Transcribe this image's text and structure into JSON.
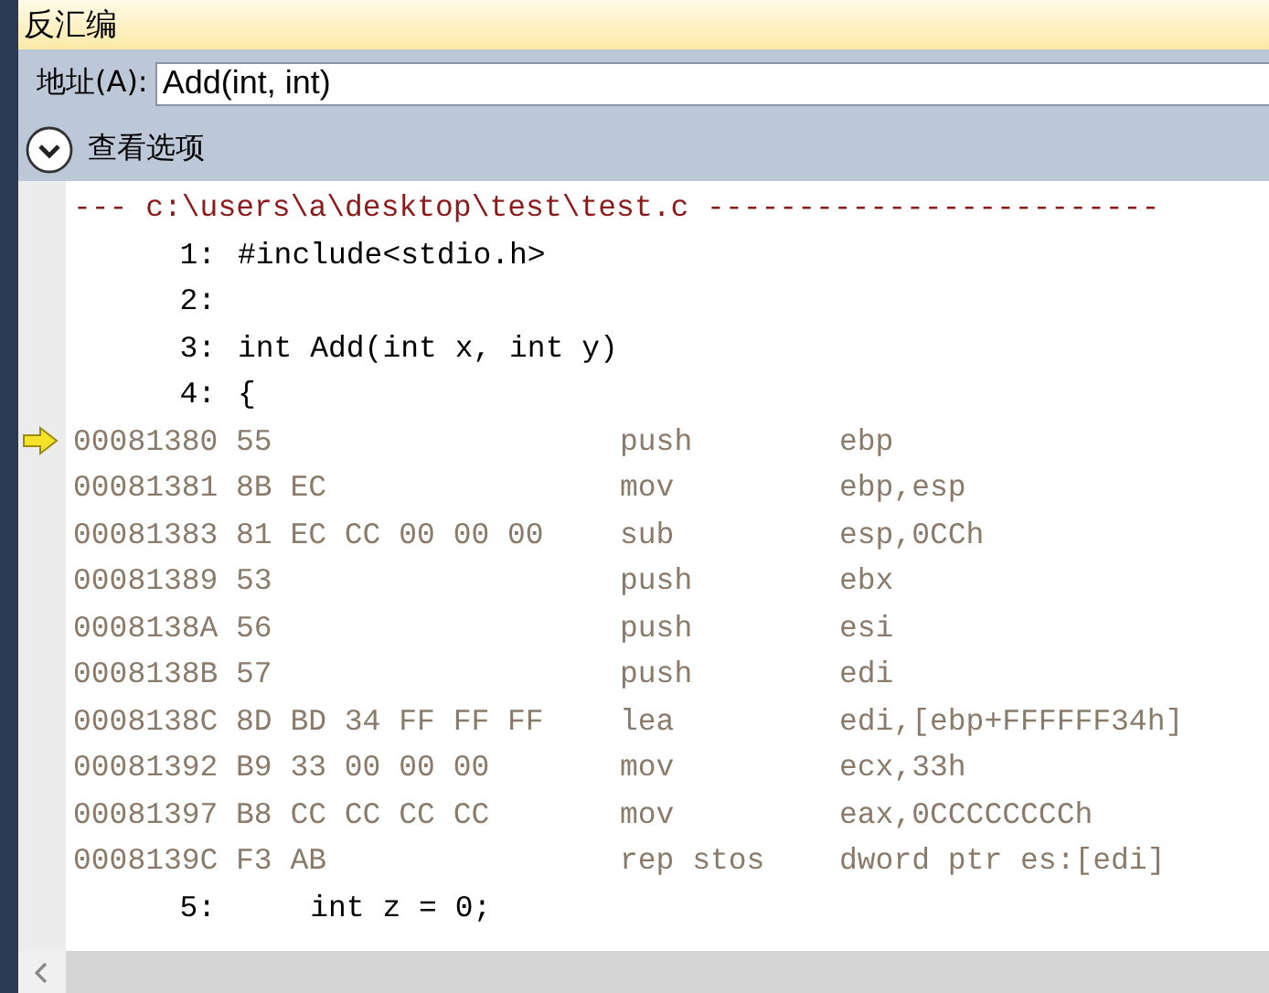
{
  "window": {
    "title": "反汇编"
  },
  "address": {
    "label": "地址(A):",
    "value": "Add(int, int)"
  },
  "options": {
    "label": "查看选项",
    "expanded": false
  },
  "lines": [
    {
      "kind": "file",
      "text": "--- c:\\users\\a\\desktop\\test\\test.c -------------------------"
    },
    {
      "kind": "source",
      "number": "1:",
      "text": "#include<stdio.h>"
    },
    {
      "kind": "source",
      "number": "2:"
    },
    {
      "kind": "source",
      "number": "3:",
      "text": "int Add(int x, int y)"
    },
    {
      "kind": "source",
      "number": "4:",
      "text": "{"
    },
    {
      "kind": "asm",
      "address": "00081380",
      "bytes": "55",
      "op": "push",
      "args": "ebp",
      "current": true
    },
    {
      "kind": "asm",
      "address": "00081381",
      "bytes": "8B EC",
      "op": "mov",
      "args": "ebp,esp",
      "current": false
    },
    {
      "kind": "asm",
      "address": "00081383",
      "bytes": "81 EC CC 00 00 00",
      "op": "sub",
      "args": "esp,0CCh",
      "current": false
    },
    {
      "kind": "asm",
      "address": "00081389",
      "bytes": "53",
      "op": "push",
      "args": "ebx",
      "current": false
    },
    {
      "kind": "asm",
      "address": "0008138A",
      "bytes": "56",
      "op": "push",
      "args": "esi",
      "current": false
    },
    {
      "kind": "asm",
      "address": "0008138B",
      "bytes": "57",
      "op": "push",
      "args": "edi",
      "current": false
    },
    {
      "kind": "asm",
      "address": "0008138C",
      "bytes": "8D BD 34 FF FF FF",
      "op": "lea",
      "args": "edi,[ebp+FFFFFF34h]",
      "current": false
    },
    {
      "kind": "asm",
      "address": "00081392",
      "bytes": "B9 33 00 00 00",
      "op": "mov",
      "args": "ecx,33h",
      "current": false
    },
    {
      "kind": "asm",
      "address": "00081397",
      "bytes": "B8 CC CC CC CC",
      "op": "mov",
      "args": "eax,0CCCCCCCCh",
      "current": false
    },
    {
      "kind": "asm",
      "address": "0008139C",
      "bytes": "F3 AB",
      "op": "rep stos",
      "args": "dword ptr es:[edi]",
      "current": false
    },
    {
      "kind": "source",
      "number": "5:",
      "text": "    int z = 0;"
    }
  ]
}
